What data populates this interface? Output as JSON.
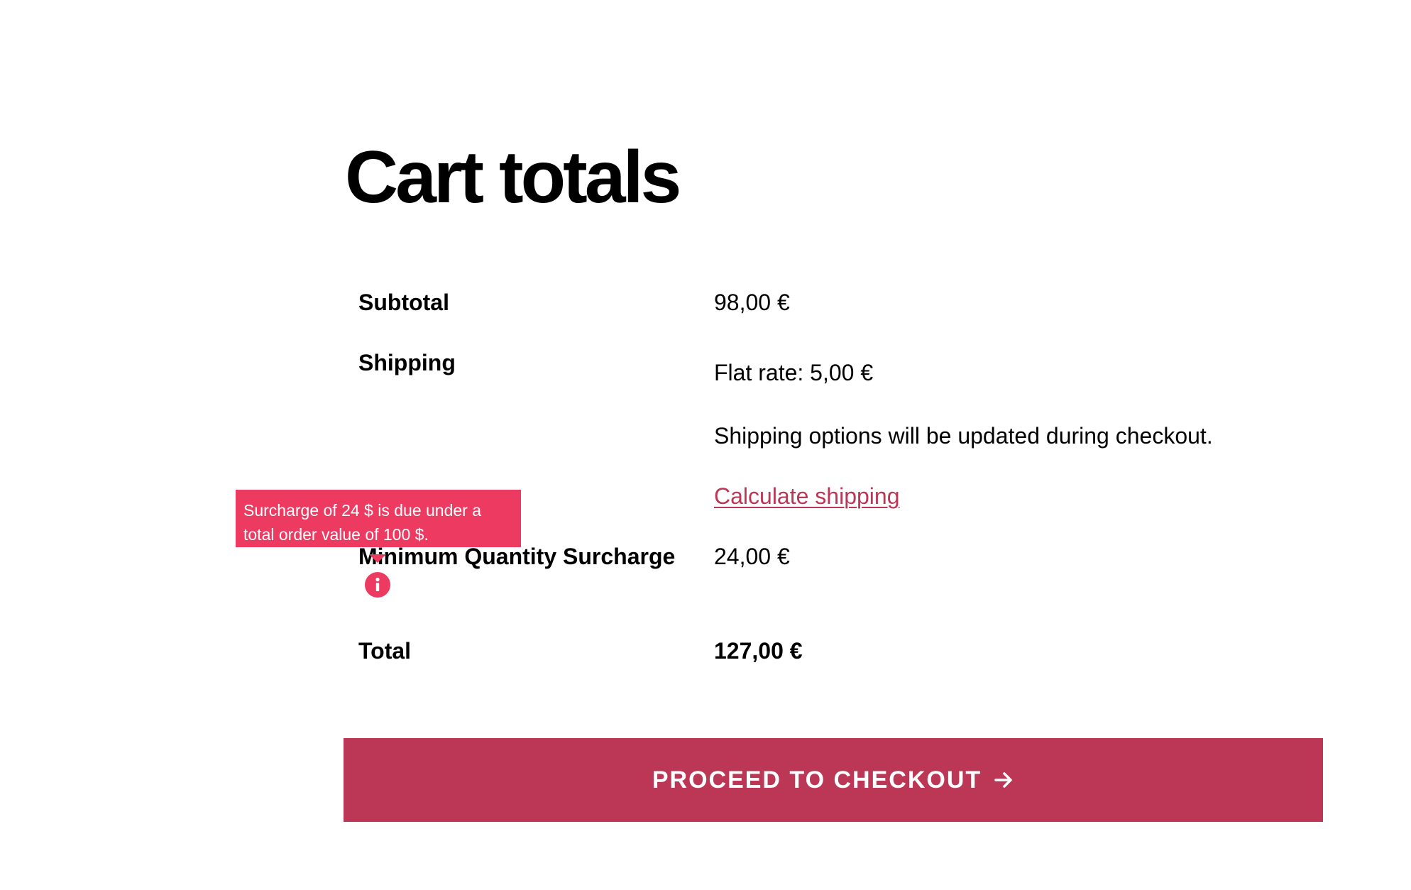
{
  "cart": {
    "title": "Cart totals",
    "subtotal": {
      "label": "Subtotal",
      "value": "98,00 €"
    },
    "shipping": {
      "label": "Shipping",
      "method": "Flat rate: 5,00 €",
      "note": "Shipping options will be updated during checkout.",
      "calculate_link": "Calculate shipping"
    },
    "surcharge": {
      "label": "Minimum Quantity Surcharge",
      "value": "24,00 €",
      "tooltip": "Surcharge of 24 $ is due under a total order value of 100 $.",
      "info_icon": "info-icon"
    },
    "total": {
      "label": "Total",
      "value": "127,00 €"
    },
    "checkout_button": {
      "label": "PROCEED TO CHECKOUT",
      "icon": "arrow-right-icon"
    }
  },
  "colors": {
    "accent": "#bc3755",
    "tooltip": "#ec3a61",
    "text": "#000000",
    "background": "#ffffff"
  }
}
